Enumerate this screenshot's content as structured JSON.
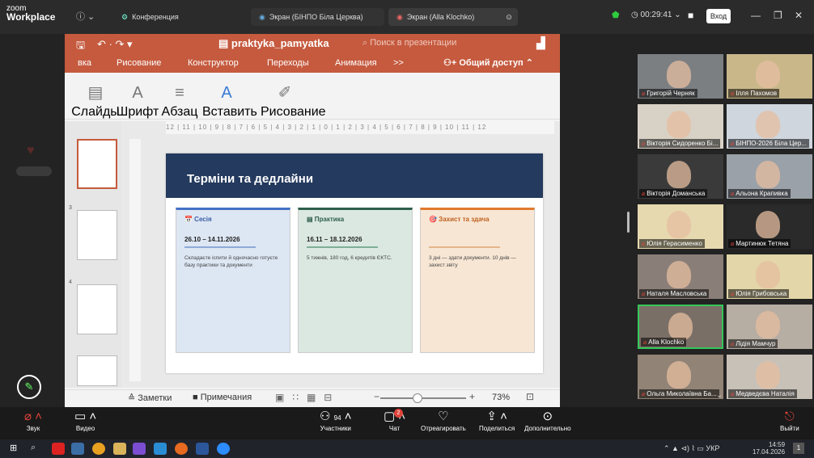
{
  "window": {
    "app_title_line1": "zoom",
    "app_title_line2": "Workplace",
    "conference_label": "Конференция",
    "tab1": "Экран (БІНПО Біла Церква)",
    "tab2": "Экран (Alla Klochko)",
    "timer": "00:29:41",
    "login": "Вход"
  },
  "ppt": {
    "filename": "praktyka_pamyatka",
    "search_placeholder": "Поиск в презентации",
    "tabs": [
      "вка",
      "Рисование",
      "Конструктор",
      "Переходы",
      "Анимация",
      ">>"
    ],
    "share_label": "Общий доступ",
    "tools": [
      "Слайды",
      "Шрифт",
      "Абзац",
      "Вставить",
      "Рисование"
    ],
    "ruler": "12 | 11 | 10 | 9 | 8 | 7 | 6 | 5 | 4 | 3 | 2 | 1 | 0 | 1 | 2 | 3 | 4 | 5 | 6 | 7 | 8 | 9 | 10 | 11 | 12",
    "thumb_numbers": [
      "3",
      "4"
    ],
    "notes": "Заметки",
    "comments": "Примечания",
    "zoom_pct": "73%"
  },
  "slide": {
    "title": "Терміни та дедлайни",
    "cards": [
      {
        "title": "📅 Сесія",
        "dates": "26.10 – 14.11.2026",
        "body": "Складаєте іспити й одночасно готуєте базу практики та документи",
        "color": "#4472c4"
      },
      {
        "title": "▤ Практика",
        "dates": "16.11 – 18.12.2026",
        "body": "5 тижнів, 180 год, 6 кредитів ЄКТС.",
        "color": "#2e5e4e"
      },
      {
        "title": "🎯 Захист та здача",
        "dates": "",
        "body": "3 дні — здати документи. 10 днів — захист звіту",
        "color": "#e07a2e"
      }
    ]
  },
  "participants": [
    {
      "name": "Григорій Черняк",
      "bg": "#7c7f82"
    },
    {
      "name": "Ілля Пахомов",
      "bg": "#c9b78a"
    },
    {
      "name": "Вікторія Сидоренко Бі...",
      "bg": "#d8d2c6"
    },
    {
      "name": "БІНПО-2026 Біла Цер...",
      "bg": "#cfd6dd"
    },
    {
      "name": "Вікторія Доманська",
      "bg": "#3a3a3a"
    },
    {
      "name": "Альона Крапивка",
      "bg": "#9aa1a8"
    },
    {
      "name": "Юлія Герасименко",
      "bg": "#e6d9b0"
    },
    {
      "name": "Мартинюк Тетяна",
      "bg": "#2a2a2a"
    },
    {
      "name": "Наталя Масловська",
      "bg": "#8a7f78"
    },
    {
      "name": "Юлія Грибовська",
      "bg": "#e3d6a8"
    },
    {
      "name": "Alla Klochko",
      "bg": "#7a6f66"
    },
    {
      "name": "Лідія Мамчур",
      "bg": "#b6ada3"
    },
    {
      "name": "Ольга Миколаївна Ба...",
      "bg": "#918375"
    },
    {
      "name": "Медведєва Наталія",
      "bg": "#c8c1b8"
    }
  ],
  "controls": {
    "sound": "Звук",
    "video": "Видео",
    "participants": "Участники",
    "participants_count": "94",
    "chat": "Чат",
    "chat_badge": "2",
    "react": "Отреагировать",
    "share": "Поделиться",
    "more": "Дополнительно",
    "leave": "Выйти"
  },
  "tray": {
    "lang": "УКР",
    "time": "14:59",
    "date": "17.04.2026",
    "notif": "1"
  }
}
